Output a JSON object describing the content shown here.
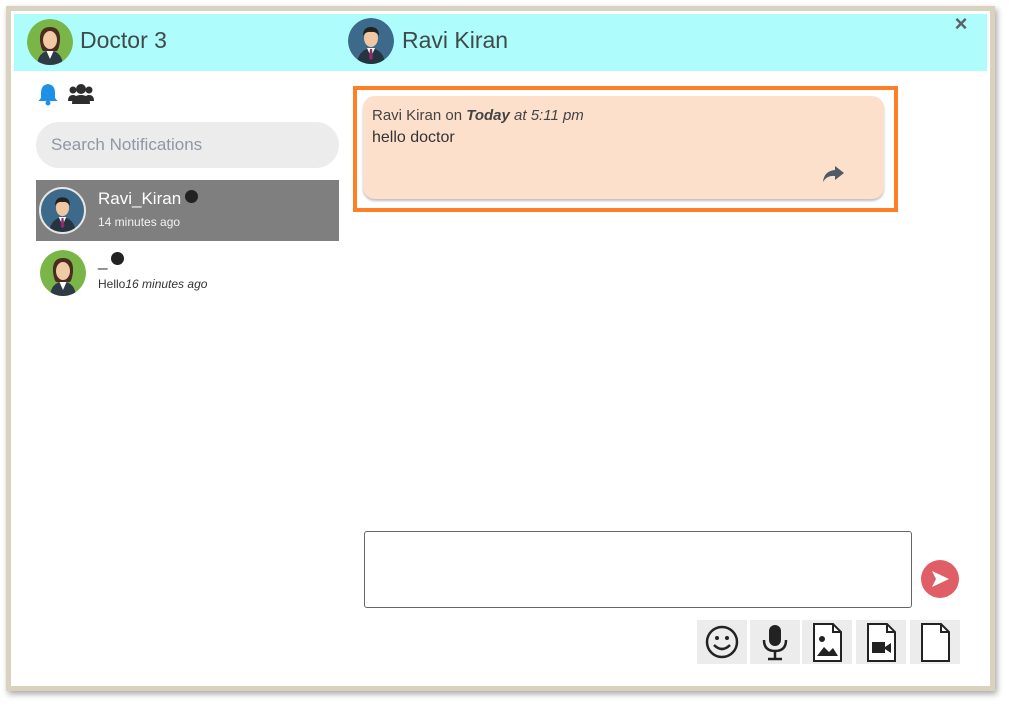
{
  "header": {
    "current_user": "Doctor 3",
    "chat_partner": "Ravi Kiran",
    "close_glyph": "×"
  },
  "sidebar": {
    "icons": [
      "bell-icon",
      "users-icon"
    ],
    "search": {
      "placeholder": "Search Notifications",
      "value": ""
    },
    "contacts": [
      {
        "name": "Ravi_Kiran",
        "sub": "14 minutes ago",
        "last_message": "",
        "active": true
      },
      {
        "name": "_",
        "last_message": "Hello",
        "sub": "16 minutes ago",
        "active": false
      }
    ]
  },
  "chat": {
    "messages": [
      {
        "sender": "Ravi Kiran",
        "on": "on",
        "day": "Today",
        "time": "at 5:11 pm",
        "text": "hello doctor"
      }
    ]
  },
  "composer": {
    "value": "",
    "tools": [
      "emoji-icon",
      "microphone-icon",
      "image-icon",
      "video-icon",
      "file-icon"
    ]
  },
  "colors": {
    "header_bg": "#aefcfc",
    "bubble_bg": "#fde0cc",
    "highlight": "#ff7f27",
    "send_button": "#e05f66",
    "bell": "#1e90e8",
    "active_contact_bg": "#7f7f7f"
  }
}
